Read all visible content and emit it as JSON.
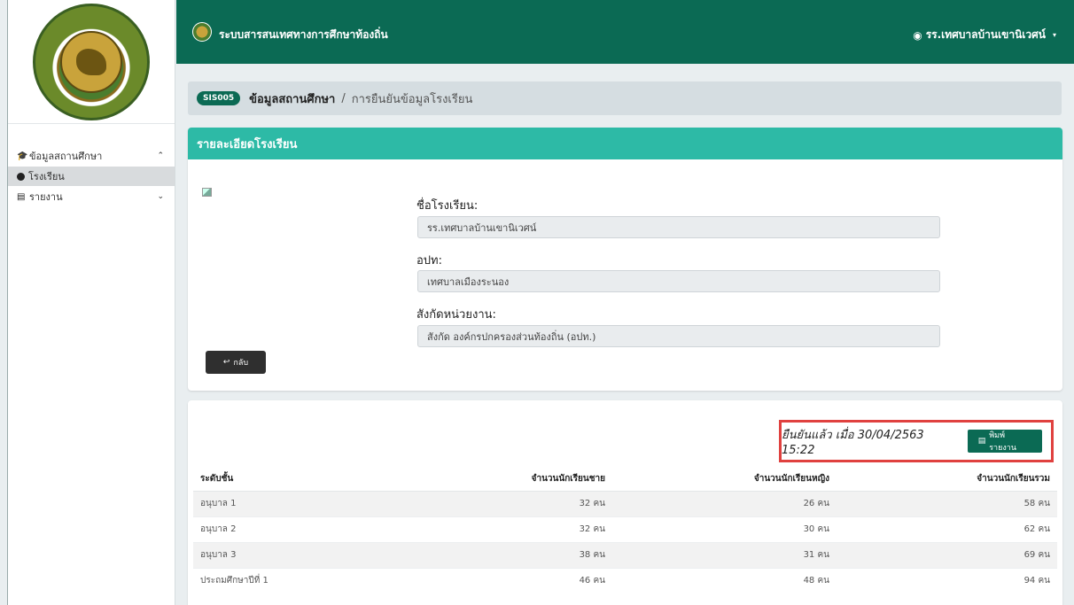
{
  "header": {
    "app_title": "ระบบสารสนเทศทางการศึกษาท้องถิ่น",
    "user_label": "รร.เทศบาลบ้านเขานิเวศน์",
    "user_caret": "▾"
  },
  "sidebar": {
    "items": [
      {
        "label": "ข้อมูลสถานศึกษา",
        "chevron": "⌃"
      },
      {
        "label": "โรงเรียน"
      },
      {
        "label": "รายงาน",
        "chevron": "⌄"
      }
    ]
  },
  "breadcrumb": {
    "badge": "SIS005",
    "main": "ข้อมูลสถานศึกษา",
    "separator": "/",
    "current": "การยืนยันข้อมูลโรงเรียน"
  },
  "school_card": {
    "title": "รายละเอียดโรงเรียน",
    "fields": [
      {
        "label": "ชื่อโรงเรียน:",
        "value": "รร.เทศบาลบ้านเขานิเวศน์"
      },
      {
        "label": "อปท:",
        "value": "เทศบาลเมืองระนอง"
      },
      {
        "label": "สังกัดหน่วยงาน:",
        "value": "สังกัด องค์กรปกครองส่วนท้องถิ่น (อปท.)"
      }
    ],
    "back_label": "กลับ"
  },
  "report_card": {
    "confirm_text": "ยืนยันแล้ว เมื่อ 30/04/2563 15:22",
    "print_label": "พิมพ์รายงาน",
    "columns": [
      "ระดับชั้น",
      "จำนวนนักเรียนชาย",
      "จำนวนนักเรียนหญิง",
      "จำนวนนักเรียนรวม"
    ],
    "rows": [
      [
        "อนุบาล 1",
        "32 คน",
        "26 คน",
        "58 คน"
      ],
      [
        "อนุบาล 2",
        "32 คน",
        "30 คน",
        "62 คน"
      ],
      [
        "อนุบาล 3",
        "38 คน",
        "31 คน",
        "69 คน"
      ],
      [
        "ประถมศึกษาปีที่ 1",
        "46 คน",
        "48 คน",
        "94 คน"
      ]
    ]
  },
  "colors": {
    "topbar": "#0b6a54",
    "card_header": "#2dbaa6",
    "highlight_border": "#e0413f"
  }
}
